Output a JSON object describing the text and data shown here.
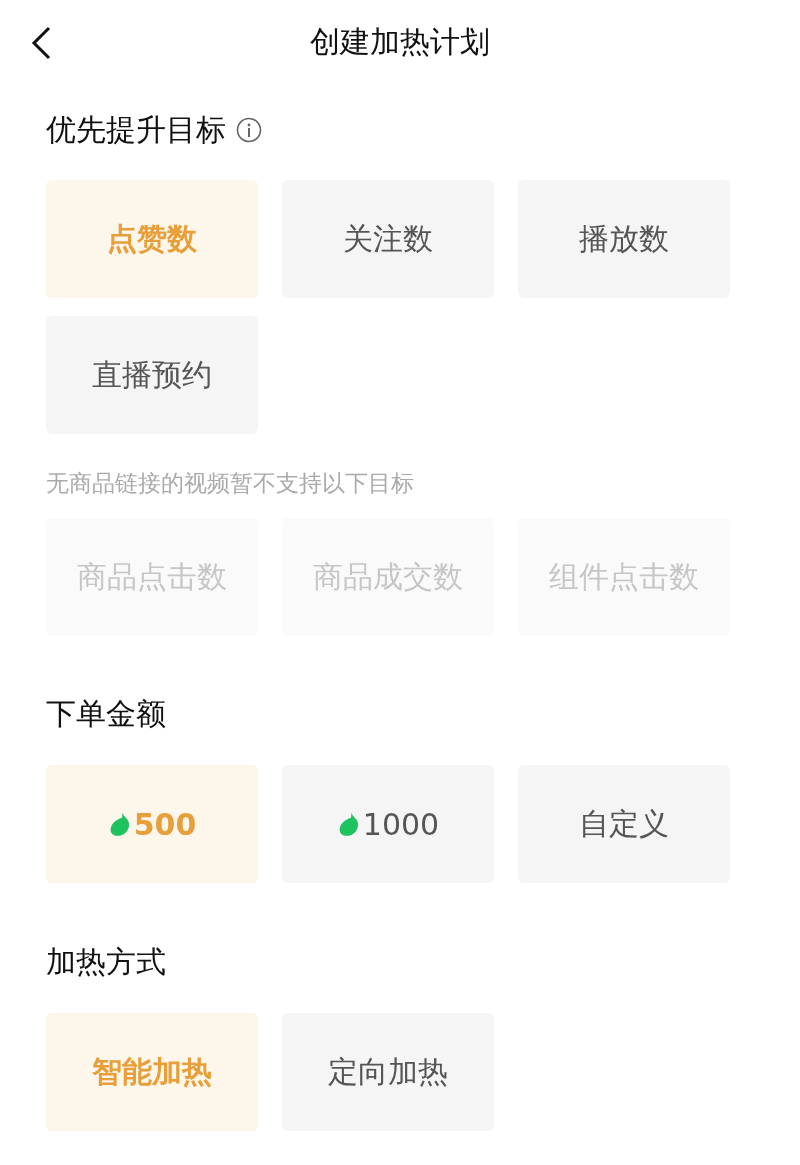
{
  "header": {
    "title": "创建加热计划"
  },
  "sections": [
    {
      "title": "优先提升目标",
      "info_icon": true,
      "groups": [
        {
          "options": [
            {
              "label": "点赞数",
              "kind": "text",
              "selected": true,
              "disabled": false
            },
            {
              "label": "关注数",
              "kind": "text",
              "selected": false,
              "disabled": false
            },
            {
              "label": "播放数",
              "kind": "text",
              "selected": false,
              "disabled": false
            },
            {
              "label": "直播预约",
              "kind": "text",
              "selected": false,
              "disabled": false
            }
          ]
        },
        {
          "note": "无商品链接的视频暂不支持以下目标",
          "options": [
            {
              "label": "商品点击数",
              "kind": "text",
              "selected": false,
              "disabled": true
            },
            {
              "label": "商品成交数",
              "kind": "text",
              "selected": false,
              "disabled": true
            },
            {
              "label": "组件点击数",
              "kind": "text",
              "selected": false,
              "disabled": true
            }
          ]
        }
      ]
    },
    {
      "title": "下单金额",
      "info_icon": false,
      "groups": [
        {
          "options": [
            {
              "label": "500",
              "kind": "coin",
              "selected": true,
              "disabled": false
            },
            {
              "label": "1000",
              "kind": "coin",
              "selected": false,
              "disabled": false
            },
            {
              "label": "自定义",
              "kind": "text",
              "selected": false,
              "disabled": false
            }
          ]
        }
      ]
    },
    {
      "title": "加热方式",
      "info_icon": false,
      "groups": [
        {
          "options": [
            {
              "label": "智能加热",
              "kind": "text",
              "selected": true,
              "disabled": false
            },
            {
              "label": "定向加热",
              "kind": "text",
              "selected": false,
              "disabled": false
            }
          ]
        }
      ]
    }
  ]
}
